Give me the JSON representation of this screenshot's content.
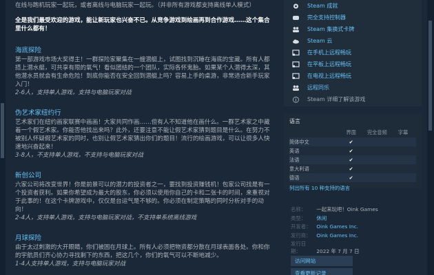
{
  "description": {
    "intro": "在线与跑机玩家一起玩，或者离线与电脑玩家一起玩。（并非所有游戏都支持离线单人模式）",
    "highlight": "全是我们最受欢迎的游戏，能让新玩家也兴奋不已。从竞争游戏到绘画再到合作游戏……这个集合里什么都有！",
    "sections": [
      {
        "title": "海底探险",
        "body": "第一部游戏市场大奖得主！一群探险家聚集在一艘潜艇上，试图找到沉睡在海底的宝藏。所有人都搭上潜水艇，可共享有限的氧气！看似团结的一个团队，实际各怀鬼胎。如果某个人潜得太深，其他潜水员就会有生命危险！到底你能否在安全回到潜艇上吗？容易上手的桌游，非常适合新手玩家入门！",
        "note": "2-6人，支持单人游戏，支持与电脑玩家对战"
      },
      {
        "title": "伪艺术家纽约行",
        "body": "艺术家们在纽约画家联赛中画画！大家共同作画……但有人不知道他在画什么。一群艺术家之中藏着一个假艺术家。你能否他找出来吗？此外，还要注意不能让假艺术家猜到题目是什么。在努力不被别人怀疑假艺术家的同时，也别让假艺术家猜出你们的题目！流行的绘画游戏，可以让很多人快速地兴奋起来！",
        "note": "3-8人，不支持单人游戏，不支持与电脑玩家对战"
      },
      {
        "title": "新创公司",
        "body": "六家公司将改变世界！你是前景可以的潜力的投资者之一，要找到投资赚钱机！包家公司找是有一个投资者获利。如果你希望成为最大的股东，你必须以使用你自己的卡和二张卡的时间，来重视对于此事的！在这个卡牌游戏中，仅仅是台运气是不够的。你必须在制定策略的同时分析对手的动向！",
        "note": "2-4人，支持单人游戏，支持与电脑玩家对战，不支持单系统离线游戏"
      },
      {
        "title": "月球探险",
        "body": "由于太过刺激的大开眼睛，你们被困在月球上。所有人必须把物资都分散在月球表面各处。你和你的宇航员们齐心协力寻找剩下的东西，把这几个，你们的氧气可以不断地减少。",
        "note": "1-4人支持单人游戏，支持与电脑玩家对战"
      }
    ]
  },
  "features": [
    {
      "icon": "gear-icon",
      "label": "Steam 成就",
      "style": "link"
    },
    {
      "icon": "steam-icon",
      "label": "完全支持控制器",
      "style": "link"
    },
    {
      "icon": "people-icon",
      "label": "Steam 集换式卡牌",
      "style": "link"
    },
    {
      "icon": "cloud-icon",
      "label": "Steam 云",
      "style": "link"
    },
    {
      "icon": "cast-icon",
      "label": "在手机上远程畅玩",
      "style": "link"
    },
    {
      "icon": "cast-icon",
      "label": "在平板上远程畅玩",
      "style": "link"
    },
    {
      "icon": "cast-icon",
      "label": "在电视上远程畅玩",
      "style": "link"
    },
    {
      "icon": "people-icon",
      "label": "远程同乐",
      "style": "link"
    },
    {
      "icon": "info-icon",
      "label": "Steam 详细了解该游戏",
      "style": "plain"
    }
  ],
  "languages": {
    "title": "语言",
    "headers": [
      "界面",
      "完全音频",
      "字幕"
    ],
    "rows": [
      {
        "name": "简体中文",
        "interface": "✔",
        "audio": "",
        "subtitles": ""
      },
      {
        "name": "英语",
        "interface": "✔",
        "audio": "",
        "subtitles": ""
      },
      {
        "name": "法语",
        "interface": "✔",
        "audio": "",
        "subtitles": ""
      },
      {
        "name": "意大利语",
        "interface": "✔",
        "audio": "",
        "subtitles": ""
      },
      {
        "name": "德语",
        "interface": "✔",
        "audio": "",
        "subtitles": ""
      }
    ],
    "more": "列出所有 10 种支持的语言"
  },
  "info": {
    "title_label": "名称：",
    "title_value": "一起来玩吧！Oink Games",
    "genre_label": "类型：",
    "genre_value": "休闲",
    "developer_label": "开发者：",
    "developer_value": "Oink Games Inc.",
    "publisher_label": "发行商：",
    "publisher_value": "Oink Games Inc.",
    "date_label": "发行日期：",
    "date_value": "2022 年 7 月 7 日"
  },
  "bottom_links": [
    "访问网站",
    "查看更新记录"
  ]
}
